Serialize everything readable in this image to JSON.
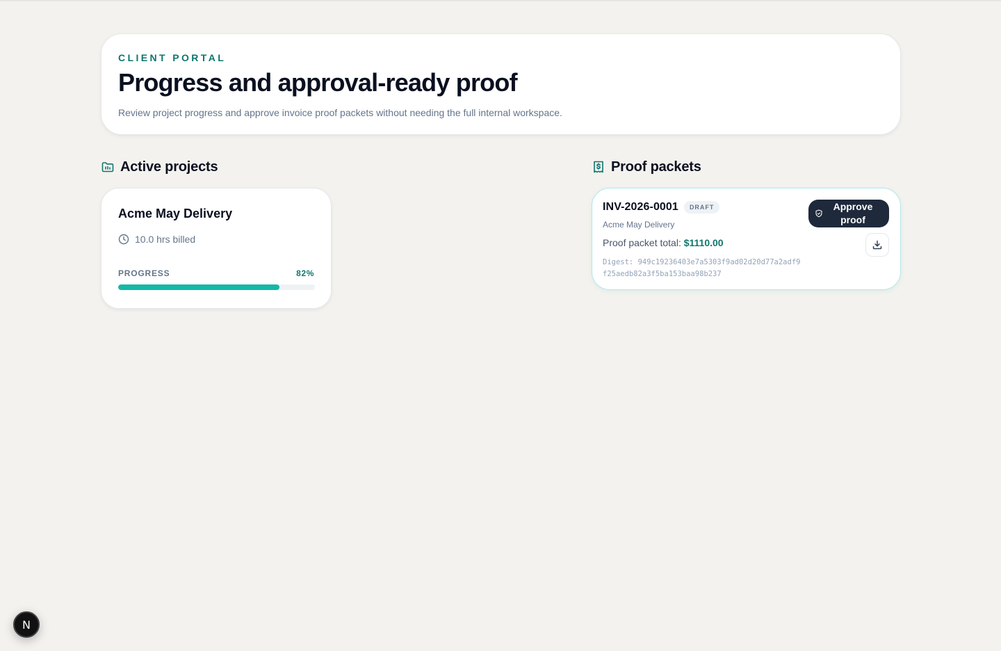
{
  "hero": {
    "eyebrow": "CLIENT PORTAL",
    "title": "Progress and approval-ready proof",
    "subtitle": "Review project progress and approve invoice proof packets without needing the full internal workspace."
  },
  "sections": {
    "projects_title": "Active projects",
    "projects_icon": "folder-chart-icon",
    "packets_title": "Proof packets",
    "packets_icon": "receipt-dollar-icon"
  },
  "projects": [
    {
      "name": "Acme May Delivery",
      "hours": "10.0 hrs billed",
      "hours_icon": "clock-icon",
      "progress_label": "PROGRESS",
      "progress_text": "82%",
      "progress_value": 0.82
    }
  ],
  "packets": [
    {
      "invoice": "INV-2026-0001",
      "status": "DRAFT",
      "project": "Acme May Delivery",
      "total_label": "Proof packet total: ",
      "total_amount": "$1110.00",
      "digest": "Digest: 949c19236403e7a5303f9ad02d20d77a2adf9f25aedb82a3f5ba153baa98b237",
      "approve_label": "Approve proof",
      "approve_icon": "shield-check-icon",
      "download_icon": "download-icon"
    }
  ],
  "dev_badge": {
    "label": "N",
    "icon": "nextjs-icon"
  },
  "colors": {
    "background": "#f4f2ee",
    "accent": "#0f766e",
    "progress": "#14b8a6",
    "button_dark": "#1e293b"
  }
}
